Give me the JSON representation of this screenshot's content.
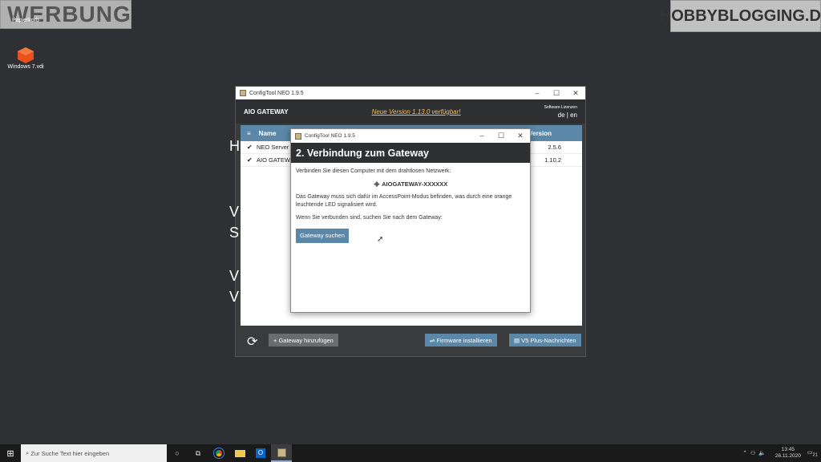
{
  "overlays": {
    "left": "WERBUNG",
    "right": "HOBBYBLOGGING.DE"
  },
  "desktop": {
    "icons": [
      {
        "label": "Papierkorb"
      },
      {
        "label": "Windows 7.vdi"
      }
    ]
  },
  "main_window": {
    "title": "ConfigTool NEO 1.9.5",
    "brand": "AIO GATEWAY",
    "update_link": "Neue Version 1.13.0 verfügbar!",
    "license_label": "Software-Lizenzen",
    "lang": {
      "de": "de",
      "sep": "|",
      "en": "en"
    },
    "table": {
      "col_name": "Name",
      "col_version": "Version",
      "rows": [
        {
          "name": "NEO Server",
          "version": "2.5.6"
        },
        {
          "name": "AIO GATEWAY",
          "version": "1.10.2"
        }
      ]
    },
    "side_letters": [
      "H",
      "V",
      "S",
      "V",
      "V"
    ],
    "buttons": {
      "add": "Gateway hinzufügen",
      "firmware": "Firmware installieren",
      "news": "V5 Plus-Nachrichten"
    }
  },
  "dialog": {
    "title": "ConfigTool NEO 1.9.5",
    "heading": "2. Verbindung zum Gateway",
    "p1": "Verbinden Sie diesen Computer mit dem drahtlosen Netzwerk:",
    "ssid": "AIOGATEWAY-XXXXXX",
    "p2": "Das Gateway muss sich dafür im AccessPoint-Modus befinden, was durch eine orange leuchtende LED signalisiert wird.",
    "p3": "Wenn Sie verbunden sind, suchen Sie nach dem Gateway:",
    "button": "Gateway suchen"
  },
  "taskbar": {
    "search_placeholder": "Zur Suche Text hier eingeben",
    "time": "13:45",
    "date": "26.11.2020",
    "notif": "21"
  }
}
